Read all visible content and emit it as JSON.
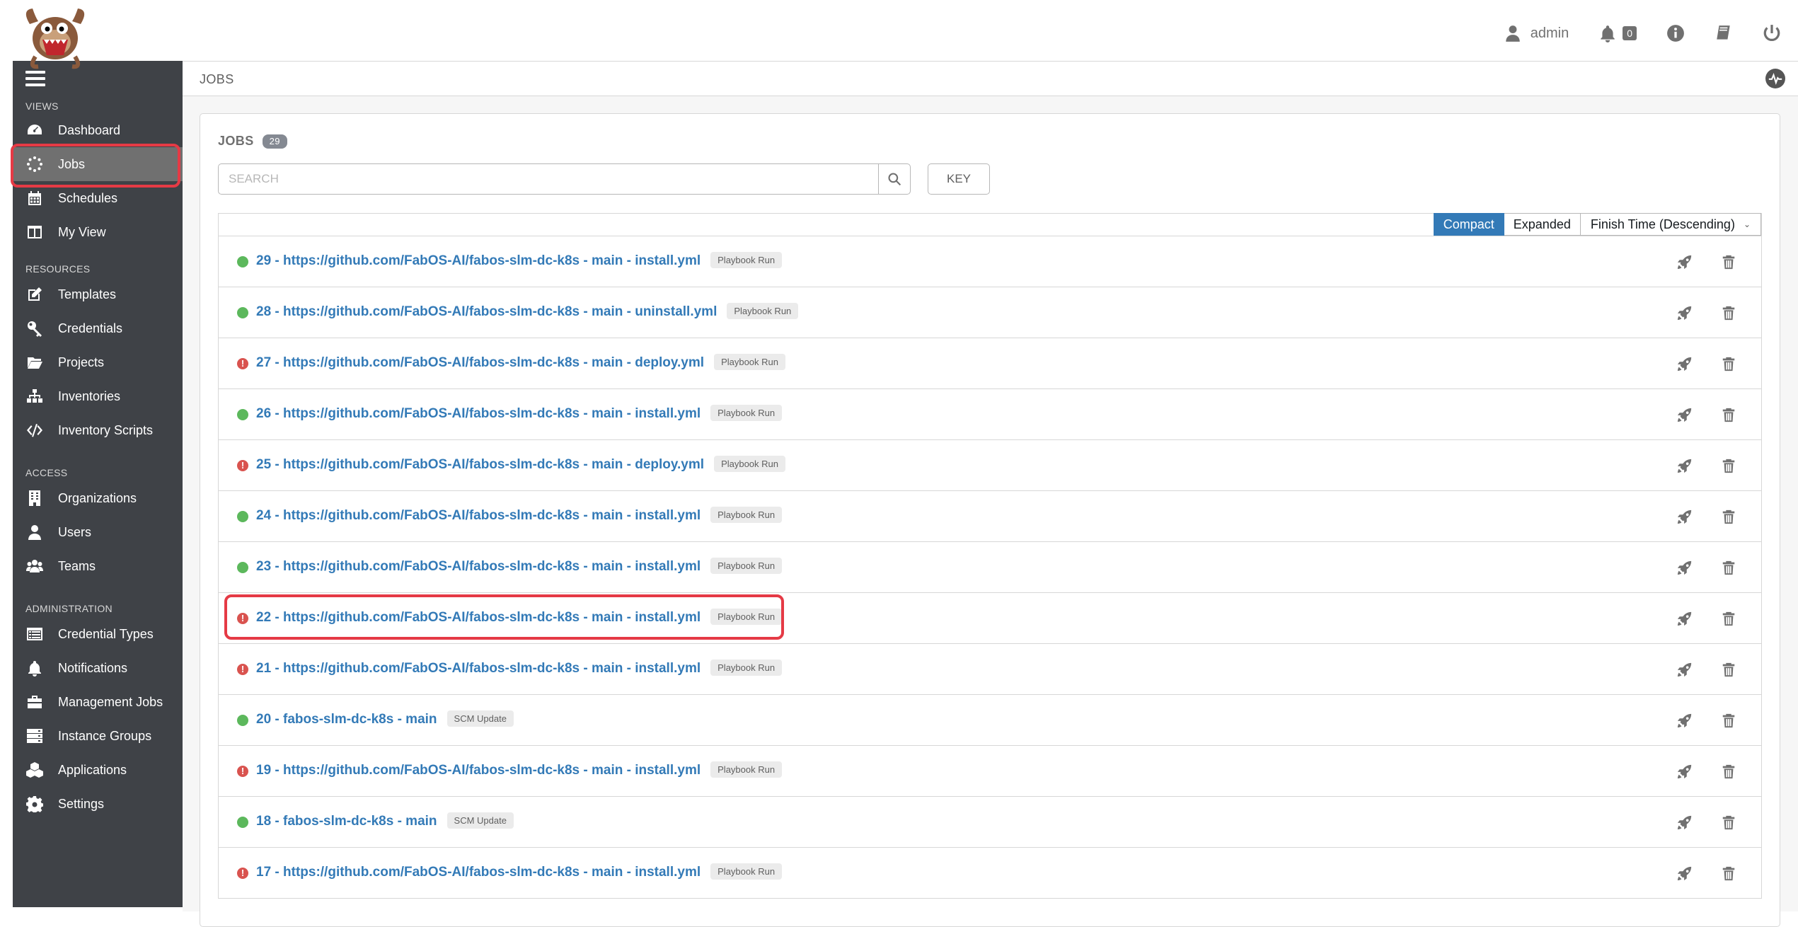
{
  "header": {
    "user_label": "admin",
    "notification_count": "0",
    "icons": [
      "user-icon",
      "bell-icon",
      "info-icon",
      "docs-book-icon",
      "power-icon"
    ]
  },
  "sidebar": {
    "sections": [
      {
        "label": "VIEWS"
      },
      {
        "label": "RESOURCES"
      },
      {
        "label": "ACCESS"
      },
      {
        "label": "ADMINISTRATION"
      }
    ],
    "items": [
      {
        "label": "Dashboard",
        "icon": "dashboard-icon"
      },
      {
        "label": "Jobs",
        "icon": "jobs-spinner-icon",
        "active": true
      },
      {
        "label": "Schedules",
        "icon": "calendar-icon"
      },
      {
        "label": "My View",
        "icon": "columns-icon"
      },
      {
        "label": "Templates",
        "icon": "edit-icon"
      },
      {
        "label": "Credentials",
        "icon": "key-icon"
      },
      {
        "label": "Projects",
        "icon": "folder-icon"
      },
      {
        "label": "Inventories",
        "icon": "sitemap-icon"
      },
      {
        "label": "Inventory Scripts",
        "icon": "code-icon"
      },
      {
        "label": "Organizations",
        "icon": "building-icon"
      },
      {
        "label": "Users",
        "icon": "user-icon"
      },
      {
        "label": "Teams",
        "icon": "users-icon"
      },
      {
        "label": "Credential Types",
        "icon": "list-alt-icon"
      },
      {
        "label": "Notifications",
        "icon": "bell-icon"
      },
      {
        "label": "Management Jobs",
        "icon": "briefcase-icon"
      },
      {
        "label": "Instance Groups",
        "icon": "server-icon"
      },
      {
        "label": "Applications",
        "icon": "cubes-icon"
      },
      {
        "label": "Settings",
        "icon": "gear-icon"
      }
    ]
  },
  "breadcrumb": {
    "label": "JOBS"
  },
  "jobs_panel": {
    "title": "JOBS",
    "count": "29",
    "search_placeholder": "SEARCH",
    "key_label": "KEY",
    "view_compact": "Compact",
    "view_expanded": "Expanded",
    "sort_label": "Finish Time (Descending)",
    "rows": [
      {
        "status": "ok",
        "name": "29 - https://github.com/FabOS-AI/fabos-slm-dc-k8s - main - install.yml",
        "type": "Playbook Run"
      },
      {
        "status": "ok",
        "name": "28 - https://github.com/FabOS-AI/fabos-slm-dc-k8s - main - uninstall.yml",
        "type": "Playbook Run"
      },
      {
        "status": "fail",
        "name": "27 - https://github.com/FabOS-AI/fabos-slm-dc-k8s - main - deploy.yml",
        "type": "Playbook Run"
      },
      {
        "status": "ok",
        "name": "26 - https://github.com/FabOS-AI/fabos-slm-dc-k8s - main - install.yml",
        "type": "Playbook Run"
      },
      {
        "status": "fail",
        "name": "25 - https://github.com/FabOS-AI/fabos-slm-dc-k8s - main - deploy.yml",
        "type": "Playbook Run"
      },
      {
        "status": "ok",
        "name": "24 - https://github.com/FabOS-AI/fabos-slm-dc-k8s - main - install.yml",
        "type": "Playbook Run"
      },
      {
        "status": "ok",
        "name": "23 - https://github.com/FabOS-AI/fabos-slm-dc-k8s - main - install.yml",
        "type": "Playbook Run"
      },
      {
        "status": "fail",
        "name": "22 - https://github.com/FabOS-AI/fabos-slm-dc-k8s - main - install.yml",
        "type": "Playbook Run",
        "highlighted": true
      },
      {
        "status": "fail",
        "name": "21 - https://github.com/FabOS-AI/fabos-slm-dc-k8s - main - install.yml",
        "type": "Playbook Run"
      },
      {
        "status": "ok",
        "name": "20 - fabos-slm-dc-k8s - main",
        "type": "SCM Update"
      },
      {
        "status": "fail",
        "name": "19 - https://github.com/FabOS-AI/fabos-slm-dc-k8s - main - install.yml",
        "type": "Playbook Run"
      },
      {
        "status": "ok",
        "name": "18 - fabos-slm-dc-k8s - main",
        "type": "SCM Update"
      },
      {
        "status": "fail",
        "name": "17 - https://github.com/FabOS-AI/fabos-slm-dc-k8s - main - install.yml",
        "type": "Playbook Run"
      }
    ]
  },
  "colors": {
    "sidebar_bg": "#3f4247",
    "active_item_bg": "#707070",
    "link_blue": "#337ab7",
    "success_green": "#5cb85c",
    "failed_red": "#d9534f",
    "annotation_red": "#e53a45"
  }
}
